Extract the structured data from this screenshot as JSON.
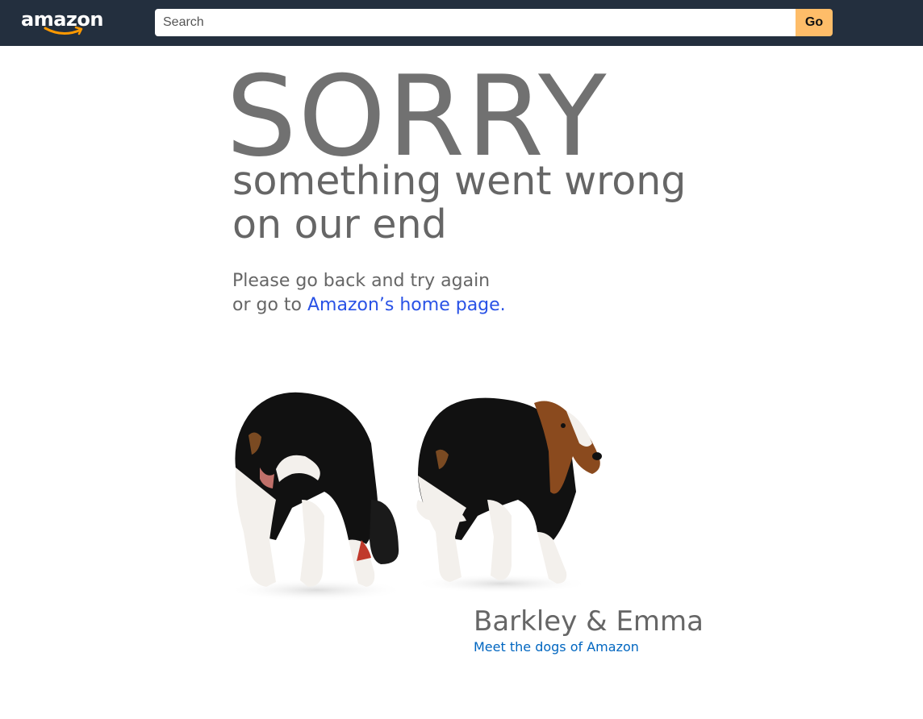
{
  "header": {
    "logo_text": "amazon",
    "search": {
      "placeholder": "Search",
      "value": ""
    },
    "go_label": "Go"
  },
  "error": {
    "headline": "SORRY",
    "subtitle_line1": "something went wrong",
    "subtitle_line2": "on our end",
    "message_line1": "Please go back and try again",
    "message_line2_prefix": "or go to ",
    "home_link": "Amazon’s home page."
  },
  "dogs": {
    "names": "Barkley & Emma",
    "link": "Meet the dogs of Amazon"
  },
  "colors": {
    "header_bg": "#232f3e",
    "go_button": "#febd69",
    "logo_smile": "#ff9900",
    "text_gray": "#666666",
    "link_blue": "#2952e6"
  }
}
